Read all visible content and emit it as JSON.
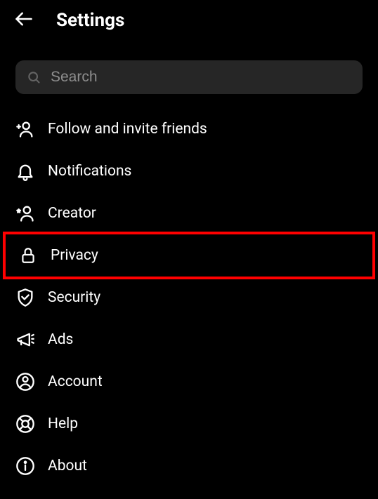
{
  "header": {
    "title": "Settings"
  },
  "search": {
    "placeholder": "Search"
  },
  "menu": {
    "items": [
      {
        "label": "Follow and invite friends"
      },
      {
        "label": "Notifications"
      },
      {
        "label": "Creator"
      },
      {
        "label": "Privacy"
      },
      {
        "label": "Security"
      },
      {
        "label": "Ads"
      },
      {
        "label": "Account"
      },
      {
        "label": "Help"
      },
      {
        "label": "About"
      }
    ]
  },
  "highlighted_index": 3
}
